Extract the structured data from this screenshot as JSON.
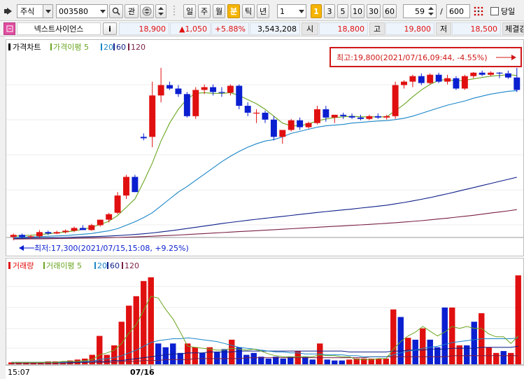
{
  "toolbar": {
    "market_type": "주식",
    "code": "003580",
    "interest_label": "관",
    "periods": [
      "일",
      "주",
      "월",
      "분",
      "틱",
      "년"
    ],
    "active_period": "분",
    "interval_value": "1",
    "minute_presets": [
      "1",
      "3",
      "5",
      "10",
      "30",
      "60"
    ],
    "active_preset": "1",
    "count_value": "59",
    "slash": "/",
    "total_value": "600",
    "today_label": "당일"
  },
  "info": {
    "stock_name": "넥스트사이언스",
    "info_label": "i",
    "price": "18,900",
    "change": "▲1,050",
    "change_pct": "+5.88%",
    "volume": "3,543,208",
    "open_label": "시",
    "open": "18,800",
    "high_label": "고",
    "high": "19,800",
    "low_label": "저",
    "low": "18,500",
    "trade_label": "체결강"
  },
  "colors": {
    "up": "#e01010",
    "down": "#0a1fd0",
    "ma5": "#6aa621",
    "ma20": "#1a86c8",
    "ma60": "#0e1f8a",
    "ma120": "#7a1f45",
    "annotation": "#d01818"
  },
  "chart_data": [
    {
      "type": "candlestick",
      "title": "가격차트",
      "legend": [
        "가격이평 5",
        "20",
        "60",
        "120"
      ],
      "y_range": [
        17200,
        19900
      ],
      "x_labels": [
        "15:07",
        "07/16"
      ],
      "annotations": {
        "high": "최고:19,800(2021/07/16,09:44, -4.55%)",
        "low": "최저:17,300(2021/07/15,15:08, +9.25%)"
      },
      "ohlc": [
        [
          17350,
          17400,
          17300,
          17380
        ],
        [
          17380,
          17400,
          17330,
          17350
        ],
        [
          17350,
          17380,
          17320,
          17360
        ],
        [
          17360,
          17450,
          17340,
          17420
        ],
        [
          17420,
          17440,
          17380,
          17400
        ],
        [
          17400,
          17440,
          17390,
          17420
        ],
        [
          17420,
          17460,
          17400,
          17440
        ],
        [
          17440,
          17500,
          17420,
          17480
        ],
        [
          17480,
          17520,
          17460,
          17450
        ],
        [
          17450,
          17540,
          17440,
          17520
        ],
        [
          17520,
          17560,
          17500,
          17600
        ],
        [
          17600,
          17700,
          17560,
          17680
        ],
        [
          17700,
          18000,
          17680,
          17950
        ],
        [
          17950,
          18250,
          17900,
          18220
        ],
        [
          18220,
          18250,
          18000,
          18000
        ],
        [
          18800,
          18850,
          18750,
          18780
        ],
        [
          18800,
          19600,
          18650,
          19400
        ],
        [
          19400,
          19800,
          19300,
          19550
        ],
        [
          19550,
          19600,
          19480,
          19500
        ],
        [
          19500,
          19550,
          19380,
          19420
        ],
        [
          19420,
          19450,
          19080,
          19100
        ],
        [
          19100,
          19520,
          19060,
          19480
        ],
        [
          19480,
          19560,
          19420,
          19520
        ],
        [
          19520,
          19560,
          19400,
          19450
        ],
        [
          19450,
          19520,
          19380,
          19440
        ],
        [
          19440,
          19560,
          19400,
          19540
        ],
        [
          19540,
          19560,
          19200,
          19250
        ],
        [
          19250,
          19300,
          19100,
          19150
        ],
        [
          19150,
          19200,
          19000,
          19150
        ],
        [
          19150,
          19180,
          19000,
          19050
        ],
        [
          19050,
          19100,
          18750,
          18800
        ],
        [
          18800,
          18850,
          18700,
          18900
        ],
        [
          18900,
          19060,
          18880,
          19040
        ],
        [
          19040,
          19080,
          18900,
          18940
        ],
        [
          18940,
          19020,
          18920,
          19000
        ],
        [
          19000,
          19250,
          18980,
          19200
        ],
        [
          19200,
          19250,
          19020,
          19080
        ],
        [
          19080,
          19120,
          19000,
          19120
        ],
        [
          19120,
          19150,
          19060,
          19100
        ],
        [
          19100,
          19140,
          19060,
          19080
        ],
        [
          19080,
          19120,
          19040,
          19060
        ],
        [
          19060,
          19120,
          19040,
          19100
        ],
        [
          19100,
          19140,
          19060,
          19080
        ],
        [
          19080,
          19120,
          19050,
          19100
        ],
        [
          19100,
          19600,
          19060,
          19550
        ],
        [
          19550,
          19620,
          19500,
          19600
        ],
        [
          19600,
          19700,
          19520,
          19680
        ],
        [
          19680,
          19720,
          19550,
          19580
        ],
        [
          19580,
          19720,
          19560,
          19700
        ],
        [
          19700,
          19730,
          19580,
          19600
        ],
        [
          19600,
          19700,
          19560,
          19650
        ],
        [
          19650,
          19680,
          19480,
          19500
        ],
        [
          19500,
          19700,
          19480,
          19680
        ],
        [
          19680,
          19740,
          19650,
          19730
        ],
        [
          19730,
          19760,
          19680,
          19700
        ],
        [
          19700,
          19750,
          19680,
          19730
        ],
        [
          19730,
          19740,
          19650,
          19720
        ],
        [
          19720,
          19760,
          19640,
          19660
        ],
        [
          19660,
          19800,
          19450,
          19480
        ]
      ],
      "ma5": [
        17360,
        17370,
        17375,
        17385,
        17395,
        17410,
        17420,
        17440,
        17460,
        17490,
        17530,
        17580,
        17660,
        17780,
        17900,
        18150,
        18420,
        18740,
        19000,
        19200,
        19350,
        19430,
        19440,
        19430,
        19430,
        19440,
        19400,
        19340,
        19280,
        19200,
        19100,
        19000,
        18960,
        18960,
        18990,
        19030,
        19060,
        19080,
        19090,
        19100,
        19090,
        19090,
        19090,
        19090,
        19180,
        19270,
        19380,
        19480,
        19560,
        19620,
        19630,
        19610,
        19620,
        19640,
        19660,
        19680,
        19690,
        19700,
        19690
      ],
      "ma20": [
        17340,
        17345,
        17350,
        17355,
        17360,
        17365,
        17370,
        17380,
        17390,
        17400,
        17420,
        17440,
        17470,
        17520,
        17570,
        17630,
        17700,
        17800,
        17900,
        18000,
        18080,
        18170,
        18260,
        18350,
        18440,
        18520,
        18590,
        18650,
        18700,
        18740,
        18760,
        18800,
        18850,
        18880,
        18910,
        18940,
        18960,
        18970,
        18980,
        19000,
        19010,
        19020,
        19030,
        19035,
        19050,
        19070,
        19100,
        19140,
        19180,
        19220,
        19260,
        19290,
        19320,
        19360,
        19390,
        19420,
        19440,
        19460,
        19470
      ],
      "ma60": [
        17330,
        17332,
        17334,
        17336,
        17338,
        17340,
        17343,
        17346,
        17350,
        17354,
        17358,
        17363,
        17370,
        17378,
        17386,
        17396,
        17408,
        17422,
        17438,
        17455,
        17472,
        17490,
        17508,
        17526,
        17544,
        17560,
        17576,
        17592,
        17606,
        17620,
        17634,
        17648,
        17662,
        17676,
        17690,
        17704,
        17718,
        17730,
        17742,
        17754,
        17768,
        17782,
        17796,
        17810,
        17830,
        17850,
        17872,
        17895,
        17920,
        17948,
        17975,
        18005,
        18035,
        18065,
        18095,
        18125,
        18155,
        18185,
        18215
      ],
      "ma120": [
        17320,
        17321,
        17322,
        17323,
        17324,
        17326,
        17328,
        17330,
        17332,
        17334,
        17336,
        17339,
        17342,
        17346,
        17350,
        17355,
        17360,
        17366,
        17372,
        17378,
        17385,
        17392,
        17399,
        17406,
        17413,
        17420,
        17427,
        17434,
        17441,
        17448,
        17455,
        17462,
        17469,
        17476,
        17483,
        17490,
        17497,
        17504,
        17511,
        17518,
        17525,
        17532,
        17540,
        17548,
        17556,
        17566,
        17576,
        17586,
        17598,
        17610,
        17622,
        17636,
        17650,
        17664,
        17680,
        17696,
        17712,
        17728,
        17746
      ]
    },
    {
      "type": "bar",
      "title": "거래량",
      "legend": [
        "거래이평 5",
        "20",
        "60",
        "120"
      ],
      "y_range": [
        0,
        100
      ],
      "values": [
        2,
        2,
        2,
        2,
        2,
        3,
        3,
        3,
        4,
        5,
        6,
        10,
        30,
        10,
        20,
        45,
        62,
        72,
        88,
        92,
        22,
        18,
        22,
        12,
        22,
        18,
        12,
        18,
        13,
        16,
        26,
        18,
        10,
        12,
        8,
        6,
        8,
        6,
        8,
        14,
        8,
        5,
        22,
        5,
        4,
        4,
        5,
        6,
        6,
        6,
        6,
        6,
        58,
        50,
        28,
        26,
        38,
        26,
        18,
        60,
        60,
        20,
        20,
        45,
        54,
        18,
        12,
        14,
        12,
        94
      ],
      "up": [
        1,
        1,
        1,
        1,
        1,
        1,
        1,
        1,
        1,
        1,
        1,
        1,
        1,
        1,
        1,
        1,
        1,
        1,
        1,
        1,
        0,
        0,
        0,
        0,
        1,
        1,
        0,
        1,
        0,
        0,
        1,
        0,
        0,
        0,
        0,
        0,
        0,
        0,
        0,
        1,
        0,
        0,
        1,
        0,
        0,
        0,
        1,
        1,
        1,
        1,
        1,
        1,
        1,
        0,
        1,
        0,
        1,
        0,
        0,
        0,
        1,
        1,
        0,
        0,
        1,
        1,
        1,
        0,
        1,
        1
      ],
      "ma5": [
        2,
        2,
        2,
        2,
        2,
        2,
        2,
        3,
        3,
        3,
        4,
        5,
        10,
        12,
        15,
        22,
        33,
        42,
        57,
        72,
        70,
        58,
        48,
        34,
        19,
        18,
        17,
        16,
        15,
        15,
        17,
        16,
        15,
        16,
        14,
        11,
        9,
        8,
        8,
        8,
        8,
        8,
        10,
        9,
        9,
        8,
        8,
        5,
        5,
        5,
        6,
        6,
        16,
        24,
        30,
        34,
        40,
        35,
        30,
        34,
        40,
        38,
        40,
        38,
        38,
        32,
        29,
        29,
        22,
        30
      ],
      "ma20": [
        2,
        2,
        2,
        2,
        2,
        2,
        2,
        2,
        3,
        3,
        3,
        3,
        5,
        6,
        7,
        9,
        12,
        15,
        19,
        23,
        25,
        26,
        27,
        27,
        28,
        27,
        26,
        25,
        24,
        22,
        20,
        18,
        17,
        16,
        15,
        14,
        13,
        13,
        12,
        12,
        11,
        11,
        11,
        10,
        10,
        10,
        9,
        9,
        8,
        8,
        8,
        8,
        10,
        12,
        14,
        15,
        17,
        18,
        19,
        21,
        23,
        24,
        25,
        26,
        27,
        27,
        27,
        27,
        27,
        28
      ],
      "ma60": [
        2,
        2,
        2,
        2,
        2,
        2,
        2,
        2,
        2,
        2,
        2,
        3,
        3,
        3,
        4,
        4,
        5,
        6,
        7,
        8,
        9,
        10,
        11,
        11,
        12,
        12,
        12,
        13,
        13,
        13,
        13,
        14,
        14,
        14,
        14,
        14,
        14,
        14,
        14,
        14,
        14,
        14,
        14,
        14,
        14,
        14,
        13,
        13,
        13,
        13,
        13,
        13,
        14,
        14,
        15,
        15,
        15,
        16,
        16,
        16,
        17,
        17,
        17,
        17,
        18,
        18,
        18,
        18,
        18,
        19
      ],
      "ma120": [
        1,
        1,
        1,
        1,
        1,
        1,
        1,
        1,
        1,
        2,
        2,
        2,
        2,
        2,
        2,
        3,
        3,
        3,
        4,
        4,
        4,
        5,
        5,
        5,
        5,
        6,
        6,
        6,
        6,
        6,
        6,
        6,
        7,
        7,
        7,
        7,
        7,
        7,
        7,
        7,
        7,
        7,
        7,
        7,
        7,
        7,
        7,
        7,
        7,
        8,
        8,
        8,
        8,
        8,
        8,
        8,
        8,
        8,
        8,
        8,
        9,
        9,
        9,
        9,
        9,
        9,
        9,
        9,
        9,
        9
      ]
    }
  ]
}
